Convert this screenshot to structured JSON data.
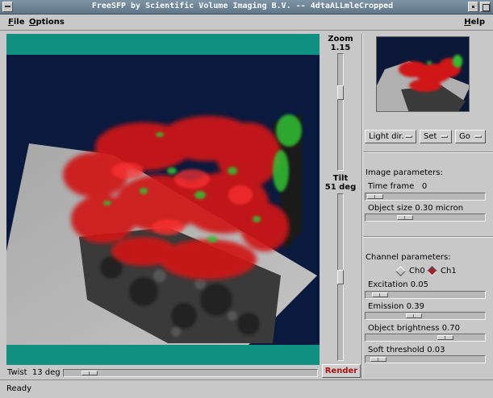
{
  "window": {
    "title": "FreeSFP by Scientific Volume Imaging B.V. -- 4dtaALLmleCropped"
  },
  "menubar": {
    "file": "File",
    "options": "Options",
    "help": "Help"
  },
  "viewer": {
    "twist_label": "Twist",
    "twist_value": "13 deg",
    "twist_fraction": 0.07,
    "zoom_label": "Zoom",
    "zoom_value": "1.15",
    "zoom_fraction": 0.3,
    "tilt_label": "Tilt",
    "tilt_value": "51 deg",
    "tilt_fraction": 0.5,
    "render_label": "Render",
    "render_color": "#b01010"
  },
  "controls": {
    "light_dir": "Light dir.",
    "set": "Set",
    "go": "Go"
  },
  "image_parameters": {
    "title": "Image parameters:",
    "time_frame_label": "Time frame",
    "time_frame_value": "0",
    "time_frame_fraction": 0.0,
    "object_size_label": "Object size",
    "object_size_value": "0.30 micron",
    "object_size_fraction": 0.3
  },
  "channel_parameters": {
    "title": "Channel parameters:",
    "channels": [
      {
        "label": "Ch0",
        "selected": false
      },
      {
        "label": "Ch1",
        "selected": true
      }
    ],
    "excitation_label": "Excitation",
    "excitation_value": "0.05",
    "excitation_fraction": 0.05,
    "emission_label": "Emission",
    "emission_value": "0.39",
    "emission_fraction": 0.39,
    "brightness_label": "Object brightness",
    "brightness_value": "0.70",
    "brightness_fraction": 0.7,
    "threshold_label": "Soft threshold",
    "threshold_value": "0.03",
    "threshold_fraction": 0.03
  },
  "status": {
    "text": "Ready"
  },
  "colors": {
    "viewport_border": "#0f9080",
    "background_scene": "#0a1a3e",
    "signal_red": "#d01818",
    "signal_green": "#30c030",
    "accent_ch1": "#a02030"
  }
}
